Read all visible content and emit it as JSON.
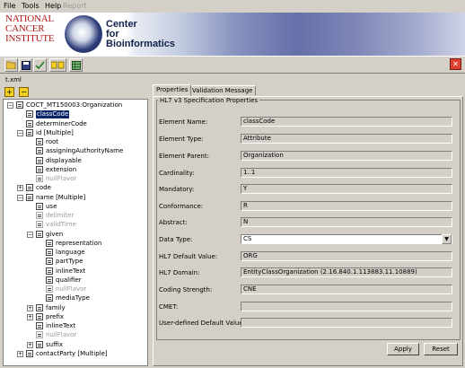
{
  "menu": {
    "file": "File",
    "tools": "Tools",
    "help": "Help",
    "report": "Report"
  },
  "banner": {
    "nci_line1": "National",
    "nci_line2": "Cancer",
    "nci_line3": "Institute",
    "center_line1": "Center",
    "center_line2": "for",
    "center_line3": "Bioinformatics"
  },
  "toolbar": {
    "icons": [
      "open-folder-icon",
      "save-icon",
      "validate-icon",
      "expand-all-icon",
      "table-icon"
    ],
    "close_label": "✕"
  },
  "file_tab": "t.xml",
  "tree_toolbar": {
    "expand_label": "+",
    "collapse_label": "−"
  },
  "tree": [
    {
      "label": "COCT_MT150003:Organization",
      "depth": 0,
      "expander": "−",
      "grey": false,
      "selected": false
    },
    {
      "label": "classCode",
      "depth": 1,
      "expander": "",
      "grey": false,
      "selected": true
    },
    {
      "label": "determinerCode",
      "depth": 1,
      "expander": "",
      "grey": false,
      "selected": false
    },
    {
      "label": "id  [Multiple]",
      "depth": 1,
      "expander": "−",
      "grey": false,
      "selected": false
    },
    {
      "label": "root",
      "depth": 2,
      "expander": "",
      "grey": false,
      "selected": false
    },
    {
      "label": "assigningAuthorityName",
      "depth": 2,
      "expander": "",
      "grey": false,
      "selected": false
    },
    {
      "label": "displayable",
      "depth": 2,
      "expander": "",
      "grey": false,
      "selected": false
    },
    {
      "label": "extension",
      "depth": 2,
      "expander": "",
      "grey": false,
      "selected": false
    },
    {
      "label": "nullFlavor",
      "depth": 2,
      "expander": "",
      "grey": true,
      "selected": false
    },
    {
      "label": "code",
      "depth": 1,
      "expander": "+",
      "grey": false,
      "selected": false
    },
    {
      "label": "name  [Multiple]",
      "depth": 1,
      "expander": "−",
      "grey": false,
      "selected": false
    },
    {
      "label": "use",
      "depth": 2,
      "expander": "",
      "grey": false,
      "selected": false
    },
    {
      "label": "delimiter",
      "depth": 2,
      "expander": "",
      "grey": true,
      "selected": false
    },
    {
      "label": "validTime",
      "depth": 2,
      "expander": "",
      "grey": true,
      "selected": false
    },
    {
      "label": "given",
      "depth": 2,
      "expander": "−",
      "grey": false,
      "selected": false
    },
    {
      "label": "representation",
      "depth": 3,
      "expander": "",
      "grey": false,
      "selected": false
    },
    {
      "label": "language",
      "depth": 3,
      "expander": "",
      "grey": false,
      "selected": false
    },
    {
      "label": "partType",
      "depth": 3,
      "expander": "",
      "grey": false,
      "selected": false
    },
    {
      "label": "inlineText",
      "depth": 3,
      "expander": "",
      "grey": false,
      "selected": false
    },
    {
      "label": "qualifier",
      "depth": 3,
      "expander": "",
      "grey": false,
      "selected": false
    },
    {
      "label": "nullFlavor",
      "depth": 3,
      "expander": "",
      "grey": true,
      "selected": false
    },
    {
      "label": "mediaType",
      "depth": 3,
      "expander": "",
      "grey": false,
      "selected": false
    },
    {
      "label": "family",
      "depth": 2,
      "expander": "+",
      "grey": false,
      "selected": false
    },
    {
      "label": "prefix",
      "depth": 2,
      "expander": "+",
      "grey": false,
      "selected": false
    },
    {
      "label": "inlineText",
      "depth": 2,
      "expander": "",
      "grey": false,
      "selected": false
    },
    {
      "label": "nullFlavor",
      "depth": 2,
      "expander": "",
      "grey": true,
      "selected": false
    },
    {
      "label": "suffix",
      "depth": 2,
      "expander": "+",
      "grey": false,
      "selected": false
    },
    {
      "label": "contactParty  [Multiple]",
      "depth": 1,
      "expander": "+",
      "grey": false,
      "selected": false
    }
  ],
  "tabs": {
    "properties": "Properties",
    "validation": "Validation Message"
  },
  "section_title": "HL7 v3 Specification Properties",
  "fields": [
    {
      "label": "Element Name:",
      "value": "classCode"
    },
    {
      "label": "Element Type:",
      "value": "Attribute"
    },
    {
      "label": "Element Parent:",
      "value": "Organization"
    },
    {
      "label": "Cardinality:",
      "value": "1..1"
    },
    {
      "label": "Mandatory:",
      "value": "Y"
    },
    {
      "label": "Conformance:",
      "value": "R"
    },
    {
      "label": "Abstract:",
      "value": "N"
    },
    {
      "label": "Data Type:",
      "value": "CS"
    },
    {
      "label": "HL7 Default Value:",
      "value": "ORG"
    },
    {
      "label": "HL7 Domain:",
      "value": "EntityClassOrganization (2.16.840.1.113883.11.10889)"
    },
    {
      "label": "Coding Strength:",
      "value": "CNE"
    },
    {
      "label": "CMET:",
      "value": ""
    },
    {
      "label": "User-defined Default Value:",
      "value": ""
    }
  ],
  "buttons": {
    "apply": "Apply",
    "reset": "Reset"
  }
}
